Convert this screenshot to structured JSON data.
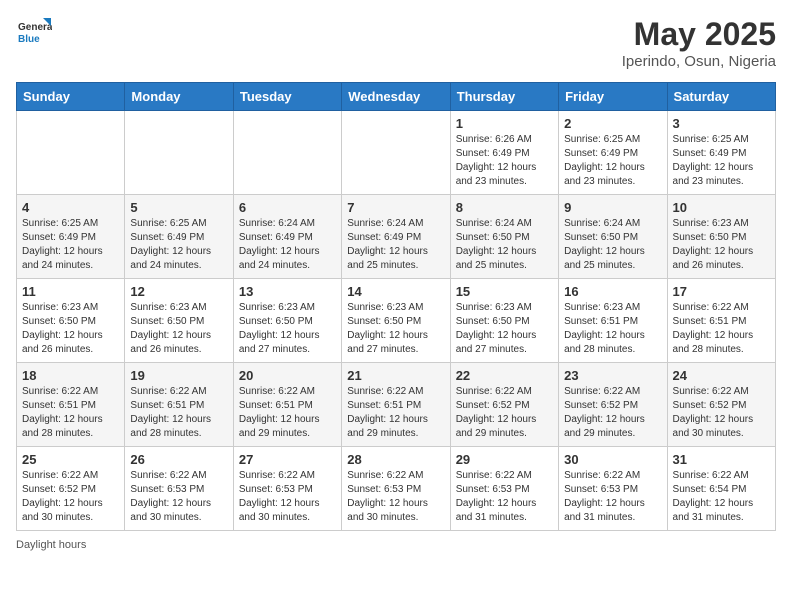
{
  "logo": {
    "general": "General",
    "blue": "Blue"
  },
  "title": "May 2025",
  "location": "Iperindo, Osun, Nigeria",
  "days_of_week": [
    "Sunday",
    "Monday",
    "Tuesday",
    "Wednesday",
    "Thursday",
    "Friday",
    "Saturday"
  ],
  "footer": "Daylight hours",
  "weeks": [
    [
      {
        "day": "",
        "info": ""
      },
      {
        "day": "",
        "info": ""
      },
      {
        "day": "",
        "info": ""
      },
      {
        "day": "",
        "info": ""
      },
      {
        "day": "1",
        "info": "Sunrise: 6:26 AM\nSunset: 6:49 PM\nDaylight: 12 hours and 23 minutes."
      },
      {
        "day": "2",
        "info": "Sunrise: 6:25 AM\nSunset: 6:49 PM\nDaylight: 12 hours and 23 minutes."
      },
      {
        "day": "3",
        "info": "Sunrise: 6:25 AM\nSunset: 6:49 PM\nDaylight: 12 hours and 23 minutes."
      }
    ],
    [
      {
        "day": "4",
        "info": "Sunrise: 6:25 AM\nSunset: 6:49 PM\nDaylight: 12 hours and 24 minutes."
      },
      {
        "day": "5",
        "info": "Sunrise: 6:25 AM\nSunset: 6:49 PM\nDaylight: 12 hours and 24 minutes."
      },
      {
        "day": "6",
        "info": "Sunrise: 6:24 AM\nSunset: 6:49 PM\nDaylight: 12 hours and 24 minutes."
      },
      {
        "day": "7",
        "info": "Sunrise: 6:24 AM\nSunset: 6:49 PM\nDaylight: 12 hours and 25 minutes."
      },
      {
        "day": "8",
        "info": "Sunrise: 6:24 AM\nSunset: 6:50 PM\nDaylight: 12 hours and 25 minutes."
      },
      {
        "day": "9",
        "info": "Sunrise: 6:24 AM\nSunset: 6:50 PM\nDaylight: 12 hours and 25 minutes."
      },
      {
        "day": "10",
        "info": "Sunrise: 6:23 AM\nSunset: 6:50 PM\nDaylight: 12 hours and 26 minutes."
      }
    ],
    [
      {
        "day": "11",
        "info": "Sunrise: 6:23 AM\nSunset: 6:50 PM\nDaylight: 12 hours and 26 minutes."
      },
      {
        "day": "12",
        "info": "Sunrise: 6:23 AM\nSunset: 6:50 PM\nDaylight: 12 hours and 26 minutes."
      },
      {
        "day": "13",
        "info": "Sunrise: 6:23 AM\nSunset: 6:50 PM\nDaylight: 12 hours and 27 minutes."
      },
      {
        "day": "14",
        "info": "Sunrise: 6:23 AM\nSunset: 6:50 PM\nDaylight: 12 hours and 27 minutes."
      },
      {
        "day": "15",
        "info": "Sunrise: 6:23 AM\nSunset: 6:50 PM\nDaylight: 12 hours and 27 minutes."
      },
      {
        "day": "16",
        "info": "Sunrise: 6:23 AM\nSunset: 6:51 PM\nDaylight: 12 hours and 28 minutes."
      },
      {
        "day": "17",
        "info": "Sunrise: 6:22 AM\nSunset: 6:51 PM\nDaylight: 12 hours and 28 minutes."
      }
    ],
    [
      {
        "day": "18",
        "info": "Sunrise: 6:22 AM\nSunset: 6:51 PM\nDaylight: 12 hours and 28 minutes."
      },
      {
        "day": "19",
        "info": "Sunrise: 6:22 AM\nSunset: 6:51 PM\nDaylight: 12 hours and 28 minutes."
      },
      {
        "day": "20",
        "info": "Sunrise: 6:22 AM\nSunset: 6:51 PM\nDaylight: 12 hours and 29 minutes."
      },
      {
        "day": "21",
        "info": "Sunrise: 6:22 AM\nSunset: 6:51 PM\nDaylight: 12 hours and 29 minutes."
      },
      {
        "day": "22",
        "info": "Sunrise: 6:22 AM\nSunset: 6:52 PM\nDaylight: 12 hours and 29 minutes."
      },
      {
        "day": "23",
        "info": "Sunrise: 6:22 AM\nSunset: 6:52 PM\nDaylight: 12 hours and 29 minutes."
      },
      {
        "day": "24",
        "info": "Sunrise: 6:22 AM\nSunset: 6:52 PM\nDaylight: 12 hours and 30 minutes."
      }
    ],
    [
      {
        "day": "25",
        "info": "Sunrise: 6:22 AM\nSunset: 6:52 PM\nDaylight: 12 hours and 30 minutes."
      },
      {
        "day": "26",
        "info": "Sunrise: 6:22 AM\nSunset: 6:53 PM\nDaylight: 12 hours and 30 minutes."
      },
      {
        "day": "27",
        "info": "Sunrise: 6:22 AM\nSunset: 6:53 PM\nDaylight: 12 hours and 30 minutes."
      },
      {
        "day": "28",
        "info": "Sunrise: 6:22 AM\nSunset: 6:53 PM\nDaylight: 12 hours and 30 minutes."
      },
      {
        "day": "29",
        "info": "Sunrise: 6:22 AM\nSunset: 6:53 PM\nDaylight: 12 hours and 31 minutes."
      },
      {
        "day": "30",
        "info": "Sunrise: 6:22 AM\nSunset: 6:53 PM\nDaylight: 12 hours and 31 minutes."
      },
      {
        "day": "31",
        "info": "Sunrise: 6:22 AM\nSunset: 6:54 PM\nDaylight: 12 hours and 31 minutes."
      }
    ]
  ]
}
